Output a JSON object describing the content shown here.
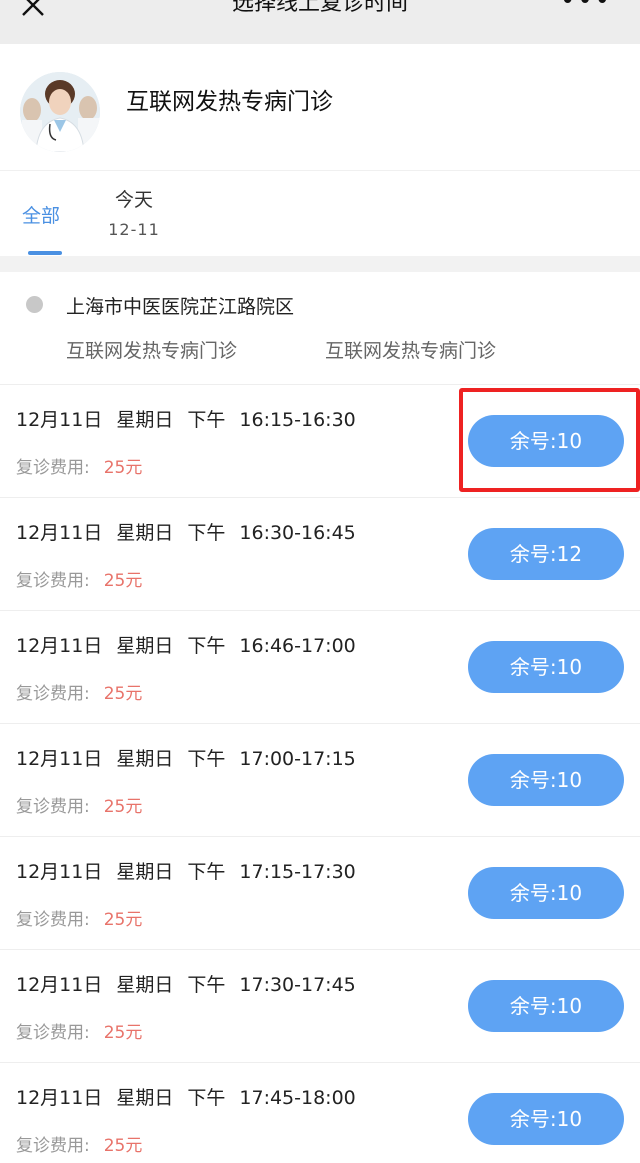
{
  "header": {
    "title": "选择线上复诊时间",
    "close_icon": "close-icon",
    "more_icon": "more-icon",
    "more_glyph": "•••",
    "close_glyph": "✕"
  },
  "clinic": {
    "name": "互联网发热专病门诊"
  },
  "tabs": [
    {
      "label": "全部",
      "active": true
    },
    {
      "label": "今天",
      "date": "12-11",
      "active": false
    }
  ],
  "hospital": {
    "name": "上海市中医医院芷江路院区",
    "departments": [
      "互联网发热专病门诊",
      "互联网发热专病门诊"
    ]
  },
  "slots": [
    {
      "date": "12月11日",
      "weekday": "星期日",
      "period": "下午",
      "time": "16:15-16:30",
      "fee_label": "复诊费用:",
      "fee": "25元",
      "remain": "余号:10",
      "highlighted": true
    },
    {
      "date": "12月11日",
      "weekday": "星期日",
      "period": "下午",
      "time": "16:30-16:45",
      "fee_label": "复诊费用:",
      "fee": "25元",
      "remain": "余号:12"
    },
    {
      "date": "12月11日",
      "weekday": "星期日",
      "period": "下午",
      "time": "16:46-17:00",
      "fee_label": "复诊费用:",
      "fee": "25元",
      "remain": "余号:10"
    },
    {
      "date": "12月11日",
      "weekday": "星期日",
      "period": "下午",
      "time": "17:00-17:15",
      "fee_label": "复诊费用:",
      "fee": "25元",
      "remain": "余号:10"
    },
    {
      "date": "12月11日",
      "weekday": "星期日",
      "period": "下午",
      "time": "17:15-17:30",
      "fee_label": "复诊费用:",
      "fee": "25元",
      "remain": "余号:10"
    },
    {
      "date": "12月11日",
      "weekday": "星期日",
      "period": "下午",
      "time": "17:30-17:45",
      "fee_label": "复诊费用:",
      "fee": "25元",
      "remain": "余号:10"
    },
    {
      "date": "12月11日",
      "weekday": "星期日",
      "period": "下午",
      "time": "17:45-18:00",
      "fee_label": "复诊费用:",
      "fee": "25元",
      "remain": "余号:10"
    }
  ],
  "colors": {
    "accent": "#4a90e2",
    "button": "#5ea3f3",
    "fee": "#e8736a",
    "highlight": "#ee2222"
  }
}
